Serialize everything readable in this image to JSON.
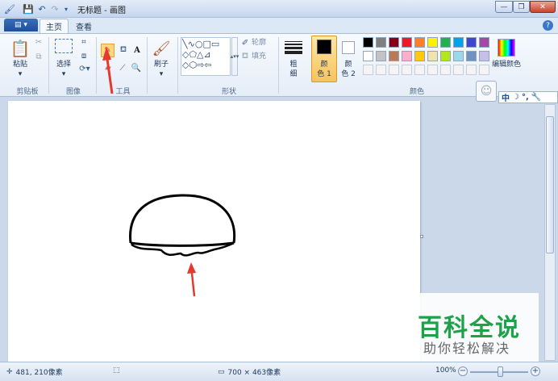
{
  "window": {
    "title": "无标题 - 画图"
  },
  "tabs": [
    {
      "label": "主页"
    },
    {
      "label": "查看"
    }
  ],
  "ribbon": {
    "clipboard": {
      "paste_label": "粘贴",
      "group_label": "剪贴板"
    },
    "image": {
      "select_label": "选择",
      "group_label": "图像"
    },
    "tools": {
      "group_label": "工具"
    },
    "brushes": {
      "label": "刷子"
    },
    "shapes": {
      "outline_label": "轮廓",
      "fill_label": "填充",
      "group_label": "形状"
    },
    "size": {
      "label_line1": "粗",
      "label_line2": "细"
    },
    "color1": {
      "label_line1": "颜",
      "label_line2": "色 1"
    },
    "color2": {
      "label_line1": "颜",
      "label_line2": "色 2"
    },
    "colors": {
      "group_label": "颜色",
      "edit_label": "编辑颜色",
      "row1": [
        "#000000",
        "#7f7f7f",
        "#880015",
        "#ed1c24",
        "#ff7f27",
        "#fff200",
        "#22b14c",
        "#00a2e8",
        "#3f48cc",
        "#a349a4"
      ],
      "row2": [
        "#ffffff",
        "#c3c3c3",
        "#b97a57",
        "#ffaec9",
        "#ffc90e",
        "#efe4b0",
        "#b5e61d",
        "#99d9ea",
        "#7092be",
        "#c8bfe7"
      ]
    },
    "color1_value": "#000000",
    "color2_value": "#ffffff"
  },
  "ime": {
    "mode_label": "中"
  },
  "status": {
    "cursor_pos": "481, 210像素",
    "canvas_size": "700 × 463像素",
    "zoom": "100%"
  },
  "watermark": {
    "title": "百科全说",
    "subtitle": "助你轻松解决"
  }
}
